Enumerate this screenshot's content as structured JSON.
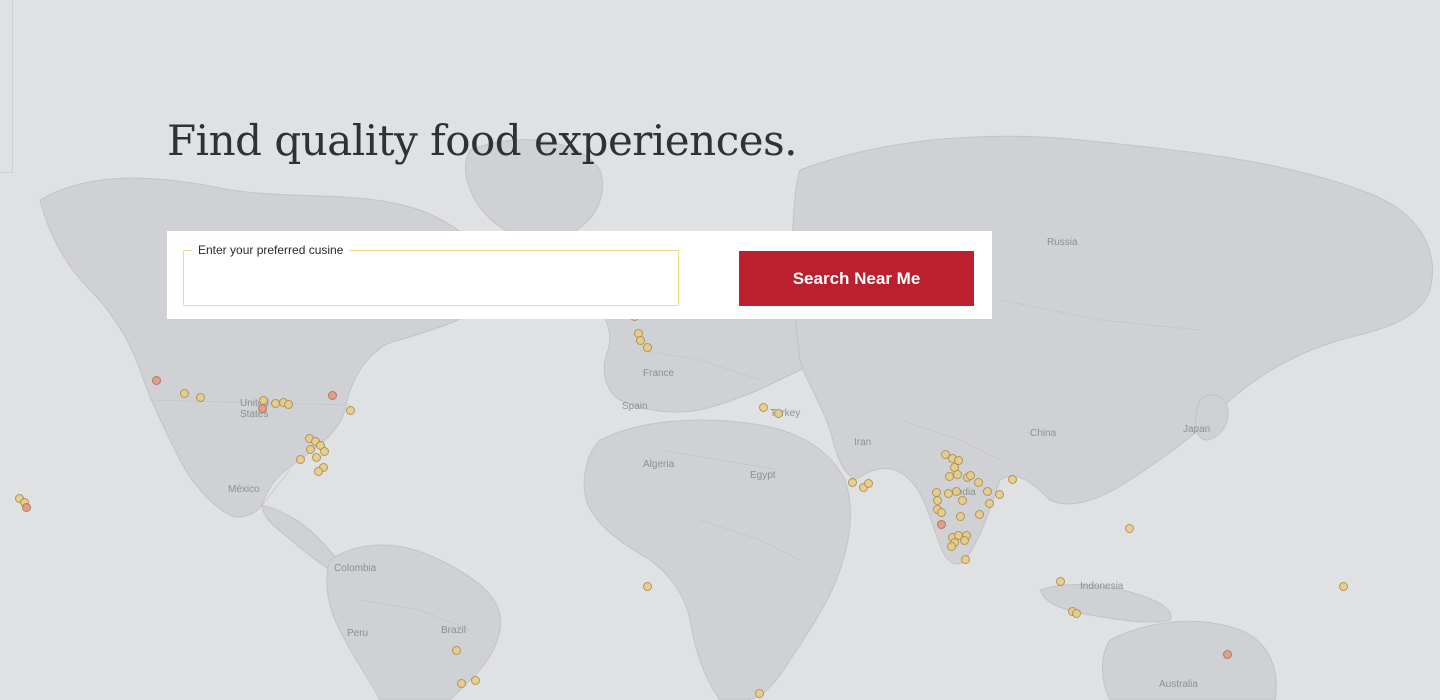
{
  "hero": {
    "headline": "Find quality food experiences."
  },
  "search": {
    "field_label": "Enter your preferred cusine",
    "input_value": "",
    "button_label": "Search Near Me"
  },
  "map": {
    "country_labels": {
      "russia": "Russia",
      "united_states": "United States",
      "mexico": "México",
      "colombia": "Colombia",
      "peru": "Peru",
      "brazil": "Brazil",
      "france": "France",
      "spain": "Spain",
      "algeria": "Algeria",
      "egypt": "Egypt",
      "turkey": "Turkey",
      "iran": "Iran",
      "india": "India",
      "china": "China",
      "japan": "Japan",
      "indonesia": "Indonesia",
      "australia": "Australia"
    },
    "marker_colors": {
      "default": "#e9cc86",
      "highlight": "#e39a7f"
    }
  }
}
